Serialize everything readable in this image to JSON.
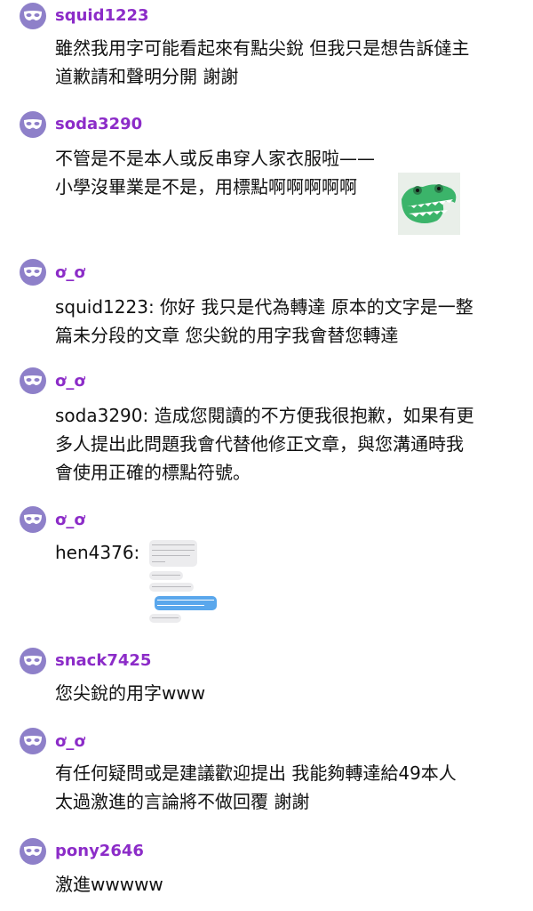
{
  "comments": [
    {
      "username": "squid1223",
      "lines": [
        "雖然我用字可能看起來有點尖銳 但我只是想告訴㒓主",
        "道歉請和聲明分開 謝謝"
      ]
    },
    {
      "username": "soda3290",
      "lines": [
        "不管是不是本人或反串穿人家衣服啦——",
        "小學沒畢業是不是，用標點啊啊啊啊啊"
      ],
      "sticker": "crocodile-sticker"
    },
    {
      "username": "ơ_ơ",
      "lines": [
        "squid1223: 你好 我只是代為轉達 原本的文字是一整",
        "篇未分段的文章 您尖銳的用字我會替您轉達"
      ]
    },
    {
      "username": "ơ_ơ",
      "lines": [
        "soda3290: 造成您閱讀的不方便我很抱歉，如果有更",
        "多人提出此問題我會代替他修正文章，與您溝通時我",
        "會使用正確的標點符號。"
      ]
    },
    {
      "username": "ơ_ơ",
      "lines": [
        "hen4376:"
      ],
      "attachment": "chat-screenshot"
    },
    {
      "username": "snack7425",
      "lines": [
        "您尖銳的用字www"
      ]
    },
    {
      "username": "ơ_ơ",
      "lines": [
        "有任何疑問或是建議歡迎提出 我能夠轉達給49本人",
        "太過激進的言論將不做回覆 謝謝"
      ]
    },
    {
      "username": "pony2646",
      "lines": [
        "激進wwwww"
      ]
    }
  ],
  "colors": {
    "username": "#8c2cc8",
    "avatar": "#8e80c9",
    "text": "#111111"
  },
  "icons": {
    "avatar": "mask-icon"
  }
}
